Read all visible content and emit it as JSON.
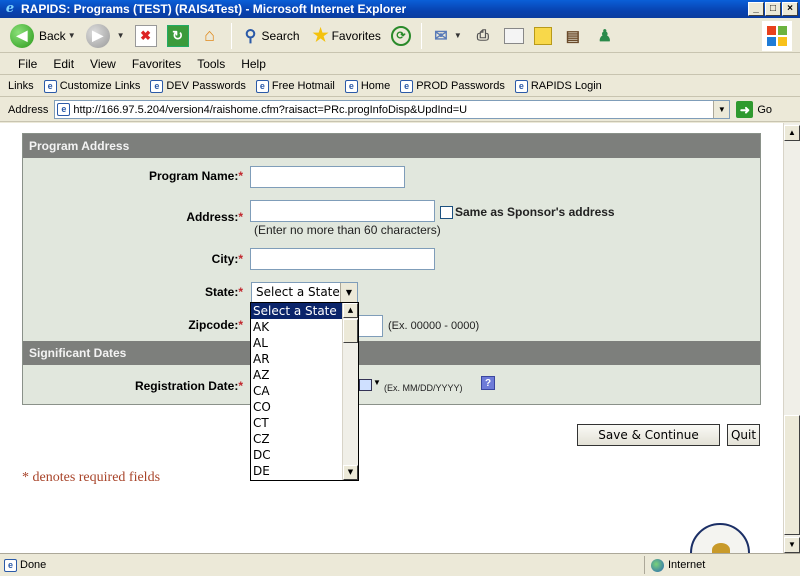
{
  "window": {
    "title": "RAPIDS: Programs  (TEST) (RAIS4Test) - Microsoft Internet Explorer",
    "buttons": [
      "_",
      "□",
      "×"
    ]
  },
  "toolbar": {
    "back_label": "Back",
    "search_label": "Search",
    "favorites_label": "Favorites"
  },
  "menu": [
    "File",
    "Edit",
    "View",
    "Favorites",
    "Tools",
    "Help"
  ],
  "links": {
    "label": "Links",
    "items": [
      "Customize Links",
      "DEV Passwords",
      "Free Hotmail",
      "Home",
      "PROD Passwords",
      "RAPIDS Login"
    ]
  },
  "address": {
    "label": "Address",
    "url": "http://166.97.5.204/version4/raishome.cfm?raisact=PRc.progInfoDisp&UpdInd=U",
    "go_label": "Go"
  },
  "form": {
    "program_address_heading": "Program Address",
    "program_name_label": "Program Name:",
    "address_label": "Address:",
    "same_as_sponsor_label": "Same as Sponsor's address",
    "address_hint": "(Enter no more than 60 characters)",
    "city_label": "City:",
    "state_label": "State:",
    "state_selected": "Select a State",
    "zipcode_label": "Zipcode:",
    "zipcode_hint": "(Ex. 00000 - 0000)",
    "significant_dates_heading": "Significant Dates",
    "registration_date_label": "Registration Date:",
    "registration_date_hint": "(Ex. MM/DD/YYYY)",
    "required_marker": "*"
  },
  "state_options": [
    "Select a State",
    "AK",
    "AL",
    "AR",
    "AZ",
    "CA",
    "CO",
    "CT",
    "CZ",
    "DC",
    "DE"
  ],
  "actions": {
    "save_label": "Save & Continue",
    "quit_label": "Quit"
  },
  "required_note": "* denotes required fields",
  "status": {
    "left": "Done",
    "zone": "Internet"
  },
  "colors": {
    "section_header": "#7d7f7c",
    "form_background": "#e1e7dd",
    "required": "#c1272d",
    "note_text": "#a8442a",
    "selection": "#0a246a"
  }
}
